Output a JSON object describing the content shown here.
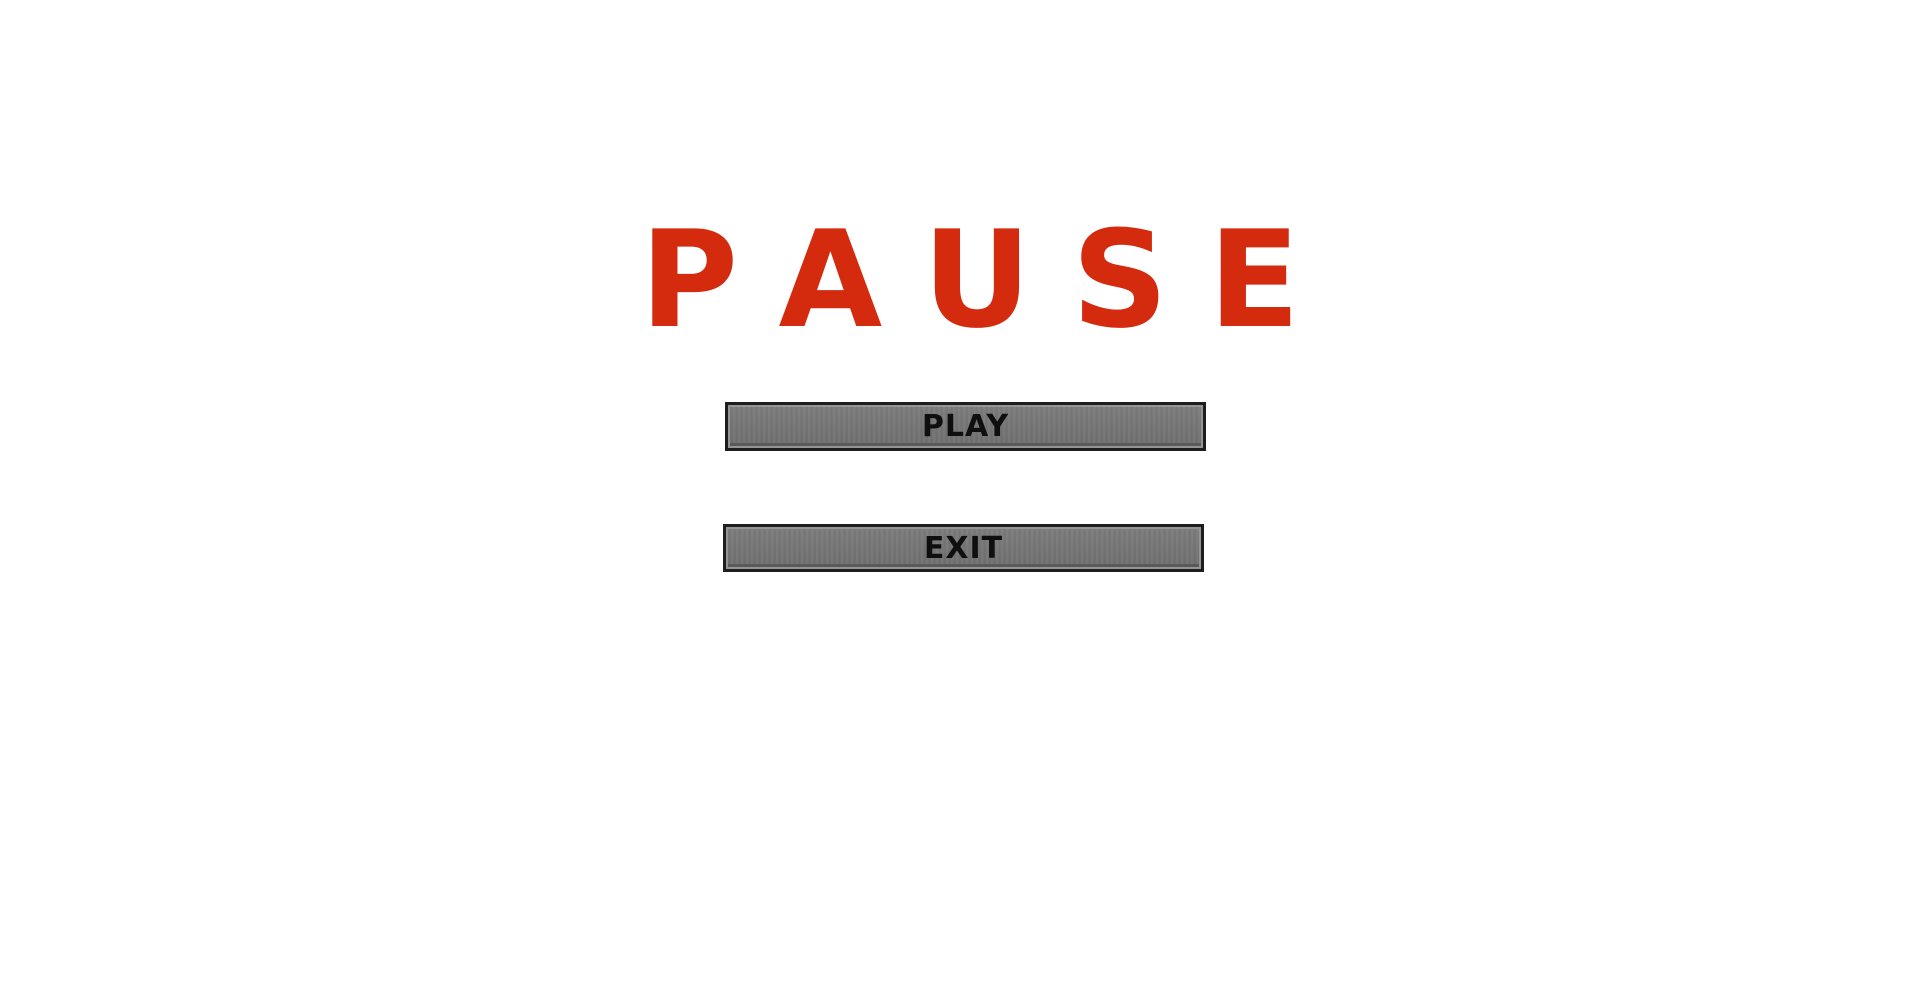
{
  "title": {
    "text": "PAUSE",
    "letters": [
      "P",
      "A",
      "U",
      "S",
      "E"
    ]
  },
  "menu": {
    "play_label": "PLAY",
    "exit_label": "EXIT"
  },
  "colors": {
    "title": "#d42a0e",
    "button_fill": "#767676",
    "button_border": "#1e1e1e",
    "button_text": "#0f0f0f",
    "background": "#ffffff"
  }
}
